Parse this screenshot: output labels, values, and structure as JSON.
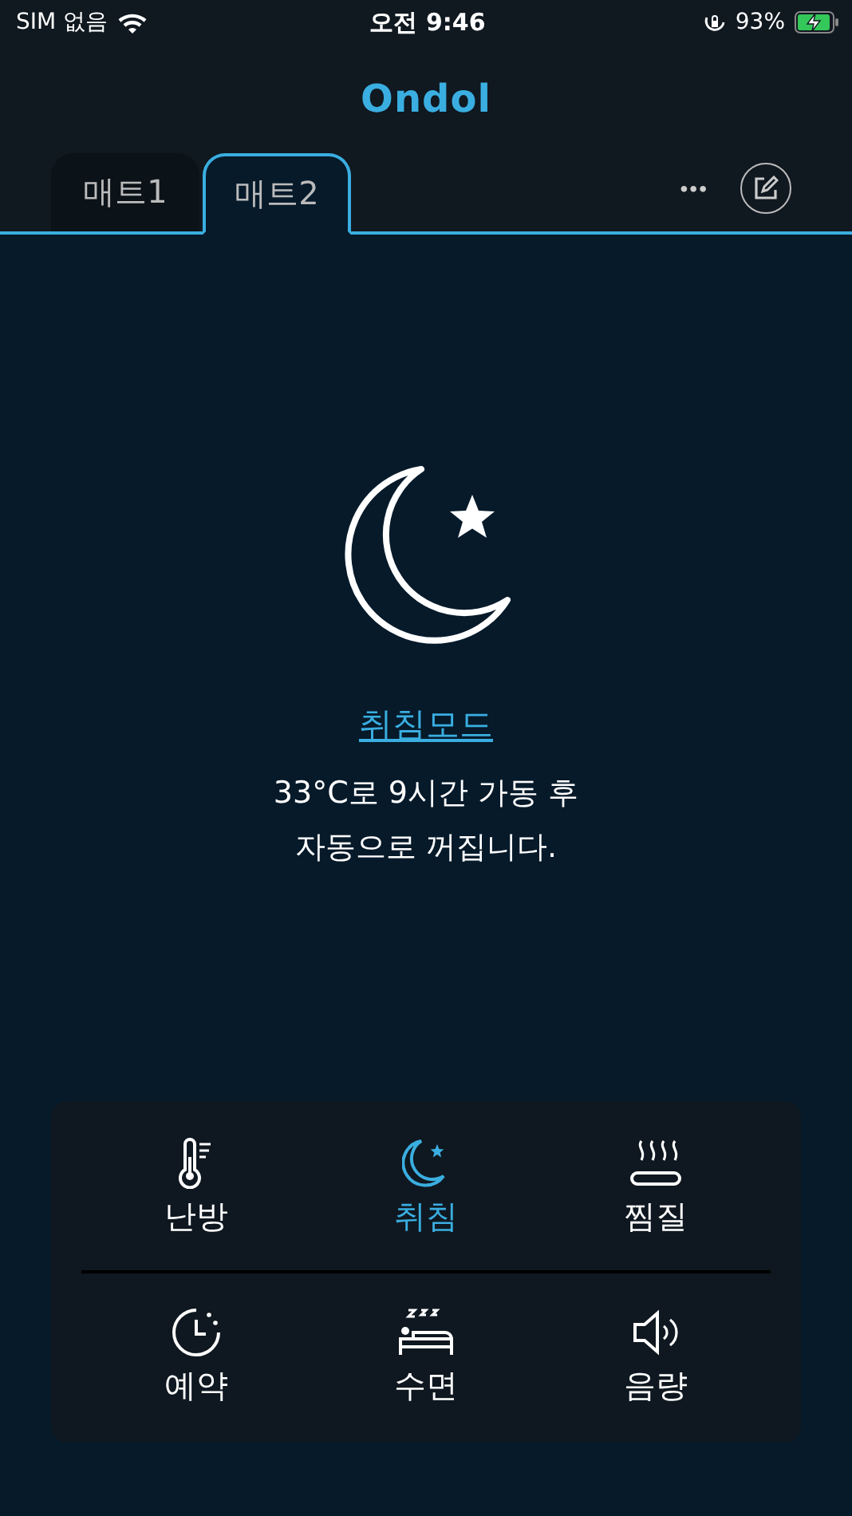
{
  "status_bar": {
    "carrier": "SIM 없음",
    "time": "오전 9:46",
    "battery_percent": "93%",
    "charging": true
  },
  "header": {
    "logo": "Ondol"
  },
  "tabs": [
    {
      "label": "매트1",
      "selected": false
    },
    {
      "label": "매트2",
      "selected": true
    }
  ],
  "toolbar": {
    "more": "•••"
  },
  "mode": {
    "title": "취침모드",
    "description_lines": [
      "33°C로 9시간 가동 후",
      "자동으로 꺼집니다."
    ]
  },
  "modes": [
    {
      "label": "난방",
      "kind": "thermometer",
      "selected": false
    },
    {
      "label": "취침",
      "kind": "moon",
      "selected": true
    },
    {
      "label": "찜질",
      "kind": "steam",
      "selected": false
    },
    {
      "label": "예약",
      "kind": "clock",
      "selected": false
    },
    {
      "label": "수면",
      "kind": "bed",
      "selected": false
    },
    {
      "label": "음량",
      "kind": "speaker",
      "selected": false
    }
  ]
}
